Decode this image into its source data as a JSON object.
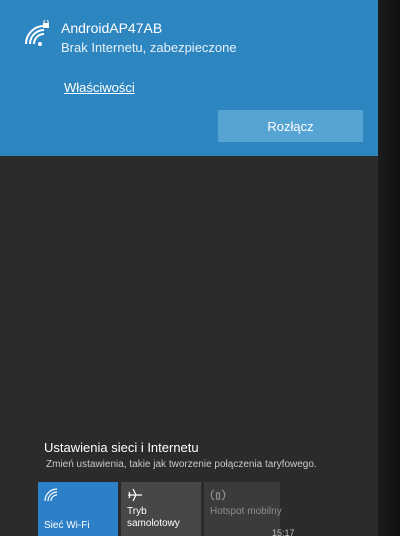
{
  "network": {
    "name": "AndroidAP47AB",
    "status": "Brak Internetu, zabezpieczone",
    "properties_link": "Właściwości",
    "disconnect_button": "Rozłącz"
  },
  "settings": {
    "title": "Ustawienia sieci i Internetu",
    "description": "Zmień ustawienia, takie jak tworzenie połączenia taryfowego."
  },
  "quick_actions": [
    {
      "label": "Sieć Wi-Fi",
      "icon": "wifi-icon",
      "state": "on"
    },
    {
      "label": "Tryb samolotowy",
      "icon": "airplane-icon",
      "state": "off"
    },
    {
      "label": "Hotspot mobilny",
      "icon": "hotspot-icon",
      "state": "disabled"
    }
  ],
  "taskbar": {
    "time": "15:17"
  },
  "colors": {
    "accent": "#2e86c1",
    "button": "#55a4d4",
    "background": "#2b2b2b"
  }
}
